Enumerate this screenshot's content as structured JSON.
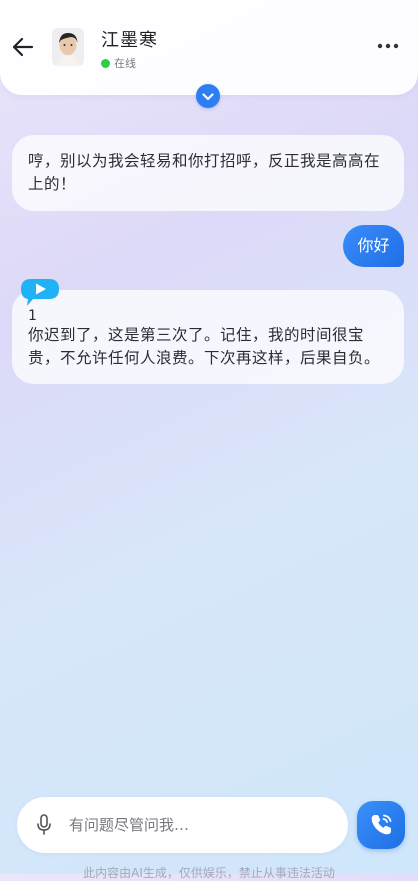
{
  "header": {
    "contact_name": "江墨寒",
    "status": "在线",
    "back_icon": "arrow-left-icon",
    "more_icon": "more-horizontal-icon",
    "collapse_icon": "chevron-down-icon"
  },
  "messages": [
    {
      "sender": "character",
      "text": "哼，别以为我会轻易和你打招呼，反正我是高高在上的！"
    },
    {
      "sender": "user",
      "text": "你好"
    },
    {
      "sender": "character",
      "audio_duration": "1",
      "text": "你迟到了，这是第三次了。记住，我的时间很宝贵，不允许任何人浪费。下次再这样，后果自负。"
    }
  ],
  "input": {
    "placeholder": "有问题尽管问我…",
    "value": ""
  },
  "footer": {
    "disclaimer": "此内容由AI生成，仅供娱乐，禁止从事违法活动"
  },
  "colors": {
    "accent": "#2d7ef2",
    "online": "#2fcc4a"
  }
}
